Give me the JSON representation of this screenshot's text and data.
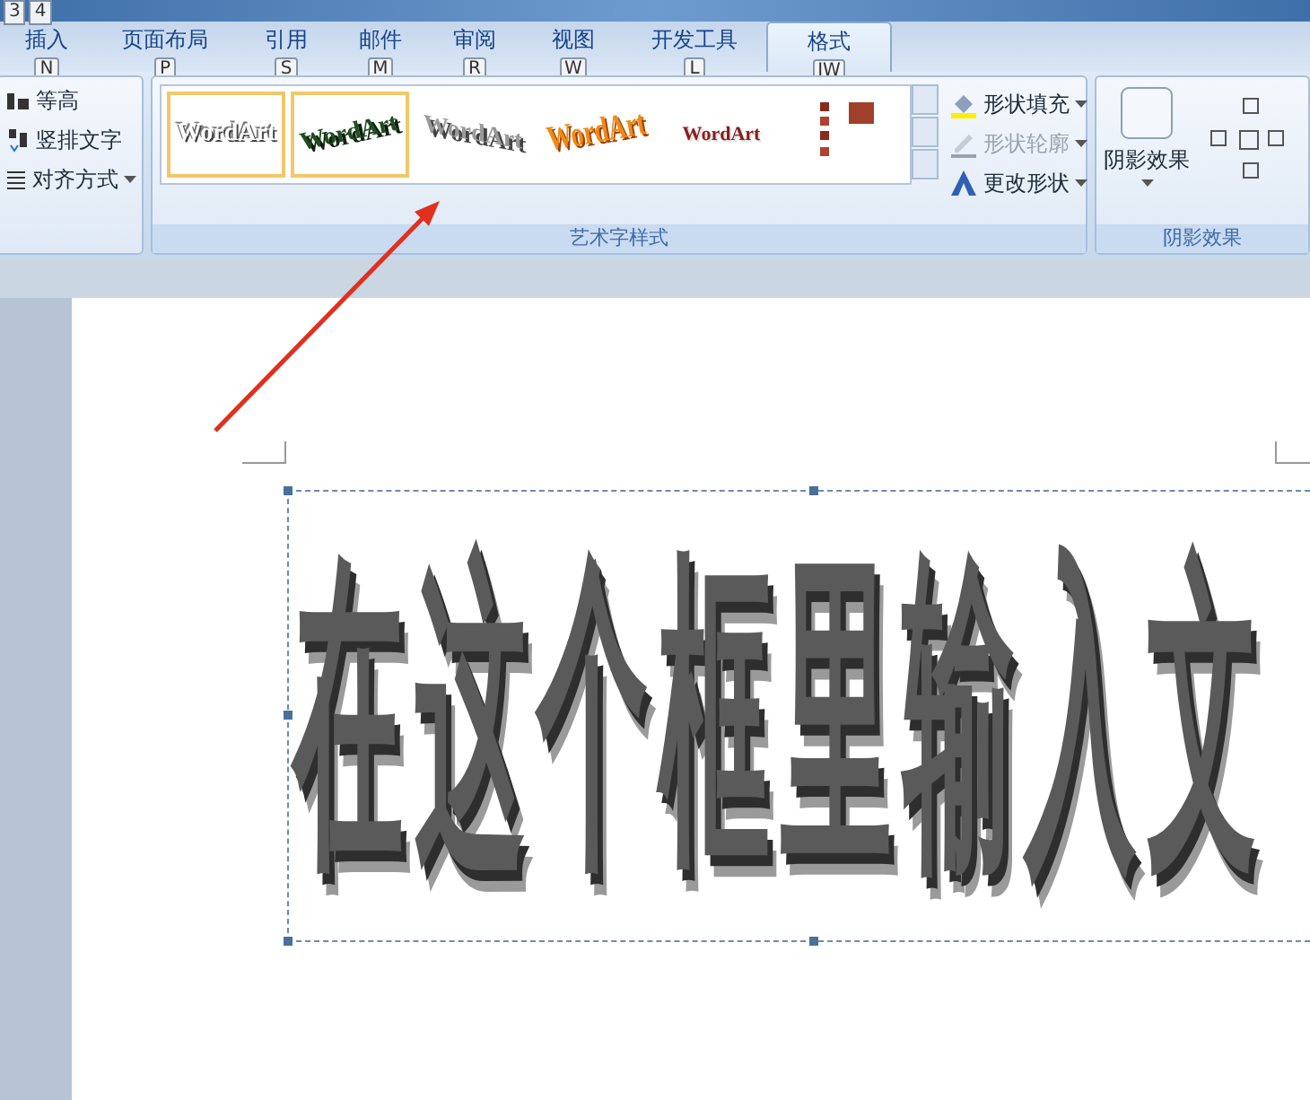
{
  "top_keytips": [
    "3",
    "4"
  ],
  "tabs": [
    {
      "label": "插入",
      "keytip": "N",
      "selected": false
    },
    {
      "label": "页面布局",
      "keytip": "P",
      "selected": false
    },
    {
      "label": "引用",
      "keytip": "S",
      "selected": false
    },
    {
      "label": "邮件",
      "keytip": "M",
      "selected": false
    },
    {
      "label": "审阅",
      "keytip": "R",
      "selected": false
    },
    {
      "label": "视图",
      "keytip": "W",
      "selected": false
    },
    {
      "label": "开发工具",
      "keytip": "L",
      "selected": false
    },
    {
      "label": "格式",
      "keytip": "JW",
      "selected": true
    }
  ],
  "text_group": {
    "items": [
      {
        "label": "等高",
        "kind": "height"
      },
      {
        "label": "竖排文字",
        "kind": "vertical"
      },
      {
        "label": "对齐方式",
        "kind": "align",
        "dropdown": true
      }
    ]
  },
  "wordart_styles": {
    "label": "艺术字样式",
    "gallery": [
      {
        "text": "WordArt",
        "kind": "outline",
        "selected": true
      },
      {
        "text": "WordArt",
        "kind": "green",
        "selected": true
      },
      {
        "text": "WordArt",
        "kind": "arch",
        "selected": false
      },
      {
        "text": "WordArt",
        "kind": "orange",
        "selected": false
      },
      {
        "text": "WordArt",
        "kind": "flat",
        "selected": false
      },
      {
        "kind": "vertical",
        "selected": false
      }
    ],
    "commands": [
      {
        "label": "形状填充",
        "kind": "fill",
        "disabled": false
      },
      {
        "label": "形状轮廓",
        "kind": "outline",
        "disabled": true
      },
      {
        "label": "更改形状",
        "kind": "shape",
        "disabled": false
      }
    ]
  },
  "shadow_group": {
    "button": "阴影效果",
    "label": "阴影效果"
  },
  "document": {
    "wordart": "在这个框里输入文"
  }
}
